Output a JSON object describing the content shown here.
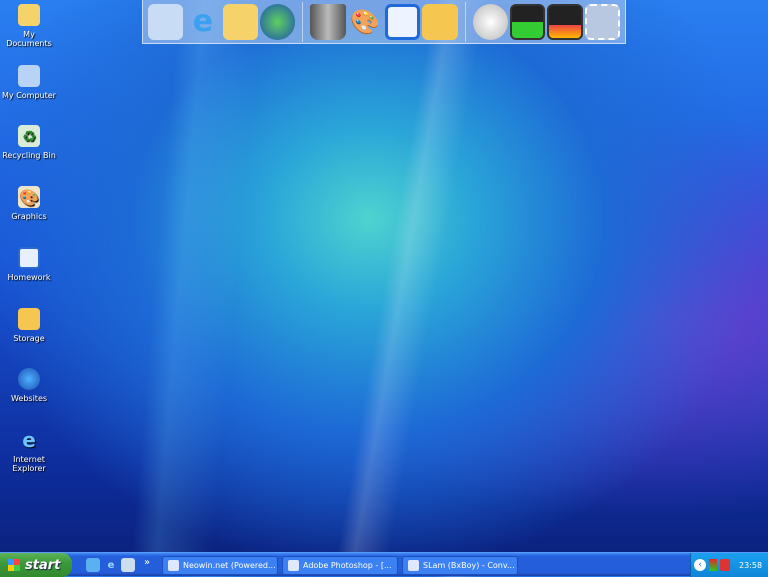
{
  "desktop_icons": [
    {
      "label": "My Documents",
      "icon": "folder-documents-icon"
    },
    {
      "label": "My Computer",
      "icon": "computer-icon"
    },
    {
      "label": "Recycling Bin",
      "icon": "recycle-bin-icon"
    },
    {
      "label": "Graphics",
      "icon": "palette-icon"
    },
    {
      "label": "Homework",
      "icon": "homework-icon"
    },
    {
      "label": "Storage",
      "icon": "folder-icon"
    },
    {
      "label": "Websites",
      "icon": "globe-icon"
    },
    {
      "label": "Internet Explorer",
      "icon": "internet-explorer-icon"
    }
  ],
  "dock": [
    "computer-icon",
    "internet-explorer-icon",
    "folder-open-icon",
    "globe-icon",
    "trash-icon",
    "palette-icon",
    "homework-icon",
    "shared-folder-icon",
    "clock-icon",
    "cpu-graph-icon",
    "network-graph-icon",
    "mail-stamp-icon"
  ],
  "taskbar": {
    "start_label": "start",
    "quick_launch_more": "»",
    "tasks": [
      {
        "label": "Neowin.net (Powered..."
      },
      {
        "label": "Adobe Photoshop - [..."
      },
      {
        "label": "SLam (BxBoy) - Conv..."
      }
    ],
    "clock": "23:58"
  }
}
